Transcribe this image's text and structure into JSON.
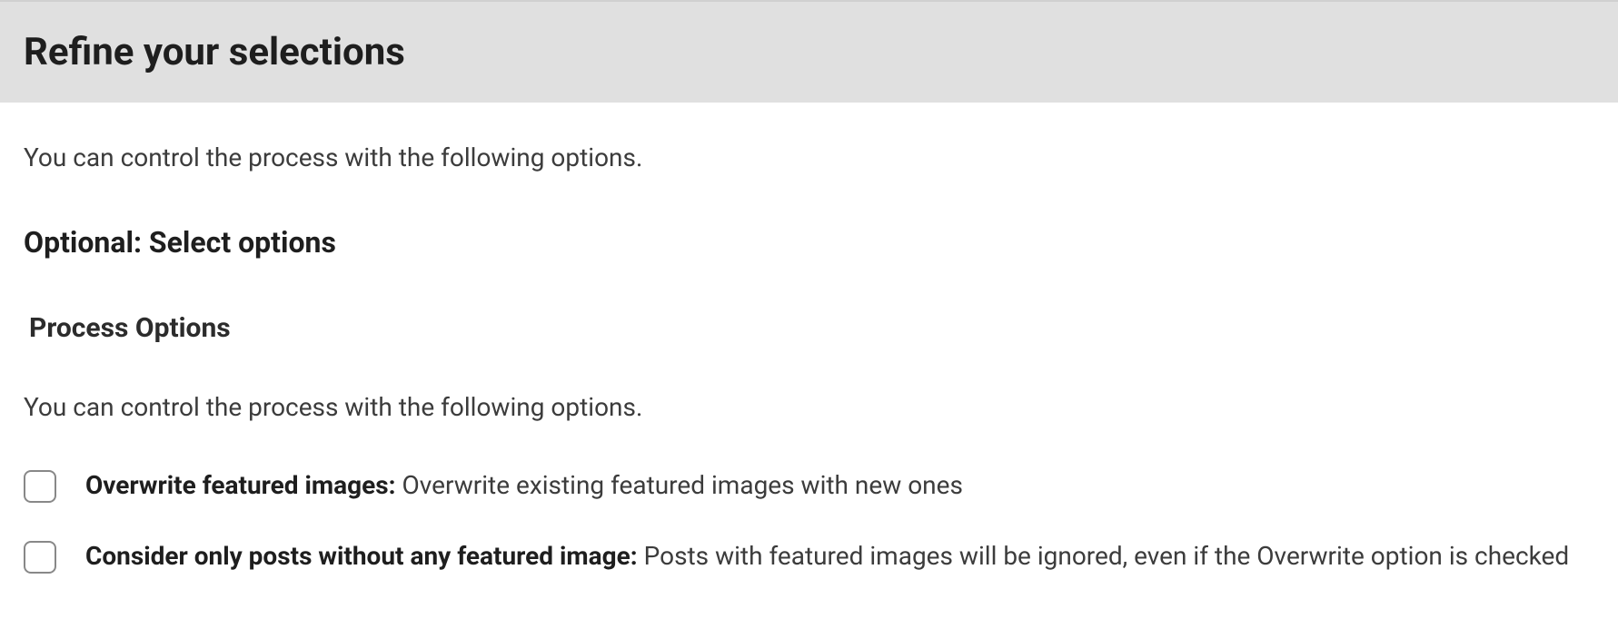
{
  "header": {
    "title": "Refine your selections"
  },
  "intro": "You can control the process with the following options.",
  "subheading": "Optional: Select options",
  "section": {
    "heading": "Process Options",
    "description": "You can control the process with the following options.",
    "options": [
      {
        "bold": "Overwrite featured images:",
        "rest": " Overwrite existing featured images with new ones"
      },
      {
        "bold": "Consider only posts without any featured image:",
        "rest": " Posts with featured images will be ignored, even if the Overwrite option is checked"
      }
    ]
  }
}
